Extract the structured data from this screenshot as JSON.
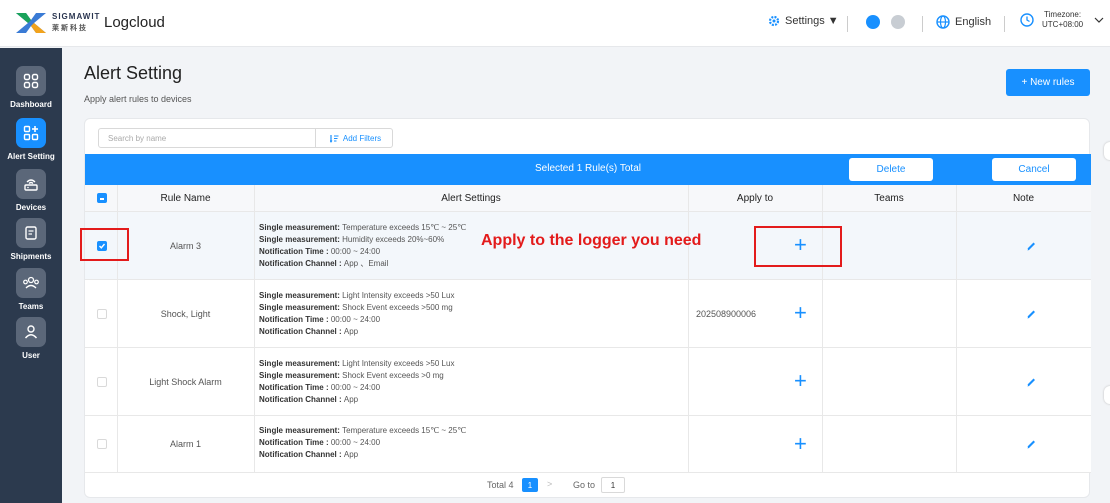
{
  "header": {
    "brand": "SIGMAWIT",
    "brand_sub": "莱斯科技",
    "app_name": "Logcloud",
    "settings_label": "Settings ▼",
    "language": "English",
    "timezone_label": "Timezone:",
    "timezone_value": "UTC+08:00"
  },
  "sidebar": {
    "items": [
      {
        "label": "Dashboard",
        "icon": "dashboard-icon"
      },
      {
        "label": "Alert Setting",
        "icon": "alert-setting-icon",
        "active": true
      },
      {
        "label": "Devices",
        "icon": "router-icon"
      },
      {
        "label": "Shipments",
        "icon": "clipboard-icon"
      },
      {
        "label": "Teams",
        "icon": "team-icon"
      },
      {
        "label": "User",
        "icon": "user-icon"
      }
    ]
  },
  "page": {
    "title": "Alert Setting",
    "subtitle": "Apply alert rules to devices",
    "new_rules_button": "+ New rules"
  },
  "toolbar": {
    "search_placeholder": "Search by name",
    "add_filters": "Add Filters"
  },
  "selection_bar": {
    "text": "Selected 1 Rule(s) Total",
    "delete_label": "Delete",
    "cancel_label": "Cancel"
  },
  "table": {
    "columns": [
      "Rule Name",
      "Alert Settings",
      "Apply to",
      "Teams",
      "Note"
    ],
    "rows": [
      {
        "name": "Alarm 3",
        "checked": true,
        "settings": [
          {
            "key": "Single measurement",
            "sep": ": ",
            "value": "Temperature exceeds 15℃ ~ 25℃"
          },
          {
            "key": "Single measurement",
            "sep": ": ",
            "value": "Humidity exceeds 20%~60%"
          },
          {
            "key": "Notification Time",
            "sep": " : ",
            "value": "00:00 ~ 24:00"
          },
          {
            "key": "Notification Channel",
            "sep": " : ",
            "value": "App 、Email"
          }
        ],
        "apply_to": ""
      },
      {
        "name": "Shock, Light",
        "checked": false,
        "settings": [
          {
            "key": "Single measurement",
            "sep": ": ",
            "value": "Light Intensity exceeds >50 Lux"
          },
          {
            "key": "Single measurement",
            "sep": ": ",
            "value": "Shock Event exceeds >500 mg"
          },
          {
            "key": "Notification Time",
            "sep": " : ",
            "value": "00:00 ~ 24:00"
          },
          {
            "key": "Notification Channel",
            "sep": " : ",
            "value": "App"
          }
        ],
        "apply_to": "202508900006"
      },
      {
        "name": "Light Shock Alarm",
        "checked": false,
        "settings": [
          {
            "key": "Single measurement",
            "sep": ": ",
            "value": "Light Intensity exceeds >50 Lux"
          },
          {
            "key": "Single measurement",
            "sep": ": ",
            "value": "Shock Event exceeds >0 mg"
          },
          {
            "key": "Notification Time",
            "sep": " : ",
            "value": "00:00 ~ 24:00"
          },
          {
            "key": "Notification Channel",
            "sep": " : ",
            "value": "App"
          }
        ],
        "apply_to": ""
      },
      {
        "name": "Alarm 1",
        "checked": false,
        "settings": [
          {
            "key": "Single measurement",
            "sep": ": ",
            "value": "Temperature exceeds 15℃ ~ 25℃"
          },
          {
            "key": "Notification Time",
            "sep": " : ",
            "value": "00:00 ~ 24:00"
          },
          {
            "key": "Notification Channel",
            "sep": " : ",
            "value": "App"
          }
        ],
        "apply_to": ""
      }
    ]
  },
  "annotation": {
    "text": "Apply to the logger you need",
    "color": "#e31b1b"
  },
  "pagination": {
    "total_label": "Total 4",
    "current_page": "1",
    "next": ">",
    "goto_label": "Go to",
    "goto_value": "1"
  },
  "colors": {
    "primary": "#1890ff",
    "sidebar": "#2c3a4e",
    "annotation": "#e31b1b"
  }
}
